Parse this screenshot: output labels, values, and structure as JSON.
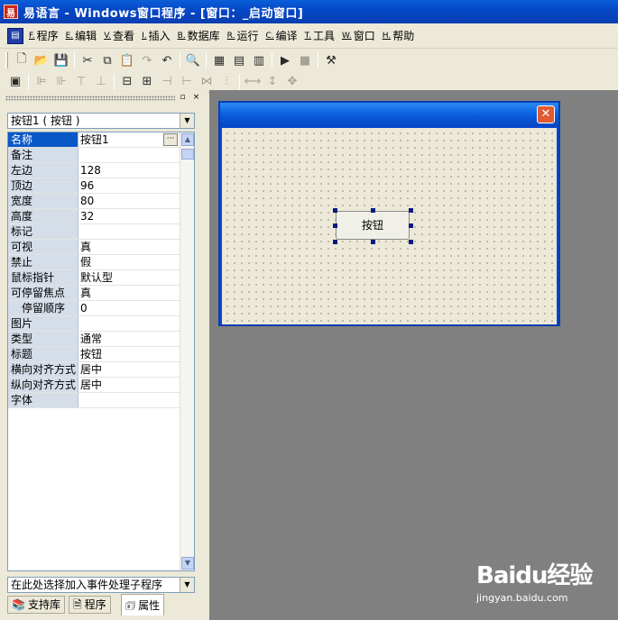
{
  "window": {
    "title": "易语言 - Windows窗口程序 - [窗口：_启动窗口]",
    "app_icon": "app-icon"
  },
  "menu": [
    {
      "key": "F.",
      "label": "程序"
    },
    {
      "key": "E.",
      "label": "编辑"
    },
    {
      "key": "V.",
      "label": "查看"
    },
    {
      "key": "I.",
      "label": "插入"
    },
    {
      "key": "B.",
      "label": "数据库"
    },
    {
      "key": "R.",
      "label": "运行"
    },
    {
      "key": "C.",
      "label": "编译"
    },
    {
      "key": "T.",
      "label": "工具"
    },
    {
      "key": "W.",
      "label": "窗口"
    },
    {
      "key": "H.",
      "label": "帮助"
    }
  ],
  "left_panel": {
    "pin": "▫",
    "close": "×",
    "object_combo": "按钮1 ( 按钮 )",
    "properties": [
      {
        "name": "名称",
        "value": "按钮1",
        "selected": true
      },
      {
        "name": "备注",
        "value": ""
      },
      {
        "name": "左边",
        "value": "128"
      },
      {
        "name": "顶边",
        "value": "96"
      },
      {
        "name": "宽度",
        "value": "80"
      },
      {
        "name": "高度",
        "value": "32"
      },
      {
        "name": "标记",
        "value": ""
      },
      {
        "name": "可视",
        "value": "真"
      },
      {
        "name": "禁止",
        "value": "假"
      },
      {
        "name": "鼠标指针",
        "value": "默认型"
      },
      {
        "name": "可停留焦点",
        "value": "真"
      },
      {
        "name": "停留顺序",
        "value": "0"
      },
      {
        "name": "图片",
        "value": ""
      },
      {
        "name": "类型",
        "value": "通常"
      },
      {
        "name": "标题",
        "value": "按钮"
      },
      {
        "name": "横向对齐方式",
        "value": "居中"
      },
      {
        "name": "纵向对齐方式",
        "value": "居中"
      },
      {
        "name": "字体",
        "value": ""
      }
    ],
    "event_combo": "在此处选择加入事件处理子程序",
    "tabs": [
      {
        "label": "支持库"
      },
      {
        "label": "程序"
      },
      {
        "label": "属性"
      }
    ]
  },
  "design": {
    "form_close": "✕",
    "button_caption": "按钮"
  },
  "watermark": {
    "logo": "Bai⁠du经验",
    "url": "jingyan.baidu.com"
  }
}
